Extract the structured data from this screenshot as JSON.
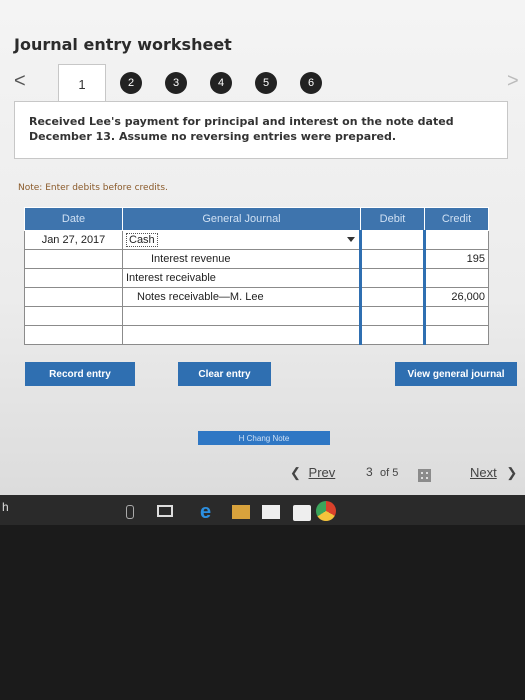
{
  "header": {
    "title": "Journal entry worksheet"
  },
  "tabs": [
    "1",
    "2",
    "3",
    "4",
    "5",
    "6"
  ],
  "nav": {
    "prev_arrow": "<",
    "next_arrow": ">"
  },
  "description": "Received Lee's payment for principal and interest on the note dated December 13. Assume no reversing entries were prepared.",
  "note": "Note: Enter debits before credits.",
  "journal": {
    "headers": {
      "date": "Date",
      "account": "General Journal",
      "debit": "Debit",
      "credit": "Credit"
    },
    "date_value": "Jan 27, 2017",
    "rows": [
      {
        "account": "Cash",
        "debit": "",
        "credit": ""
      },
      {
        "account": "Interest revenue",
        "debit": "",
        "credit": "195"
      },
      {
        "account": "Interest receivable",
        "debit": "",
        "credit": ""
      },
      {
        "account": "Notes receivable—M. Lee",
        "debit": "",
        "credit": "26,000"
      },
      {
        "account": "",
        "debit": "",
        "credit": ""
      },
      {
        "account": "",
        "debit": "",
        "credit": ""
      }
    ]
  },
  "buttons": {
    "record": "Record entry",
    "clear": "Clear entry",
    "view": "View general journal",
    "check_note": "H Chang Note"
  },
  "pager": {
    "prev": "Prev",
    "current": "3",
    "of": "of 5",
    "next": "Next"
  },
  "taskbar": {
    "left_text": "h"
  }
}
